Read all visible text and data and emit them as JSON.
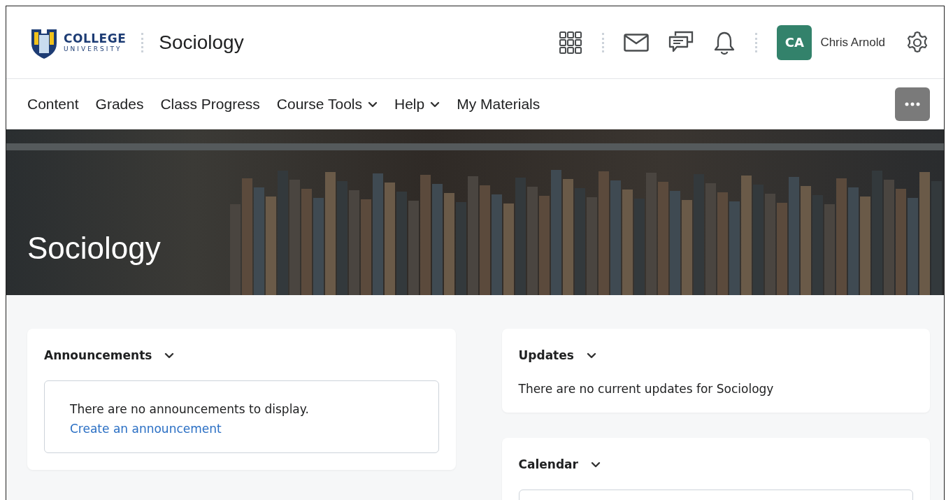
{
  "header": {
    "logo": {
      "line1": "COLLEGE",
      "line2": "UNIVERSITY"
    },
    "course_title": "Sociology",
    "user": {
      "initials": "CA",
      "name": "Chris Arnold"
    }
  },
  "nav": [
    {
      "label": "Content",
      "dropdown": false
    },
    {
      "label": "Grades",
      "dropdown": false
    },
    {
      "label": "Class Progress",
      "dropdown": false
    },
    {
      "label": "Course Tools",
      "dropdown": true
    },
    {
      "label": "Help",
      "dropdown": true
    },
    {
      "label": "My Materials",
      "dropdown": false
    }
  ],
  "banner": {
    "title": "Sociology"
  },
  "widgets": {
    "left": [
      {
        "title": "Announcements",
        "message": "There are no announcements to display.",
        "link": "Create an announcement"
      }
    ],
    "right": [
      {
        "title": "Updates",
        "text": "There are no current updates for Sociology"
      },
      {
        "title": "Calendar"
      }
    ]
  }
}
